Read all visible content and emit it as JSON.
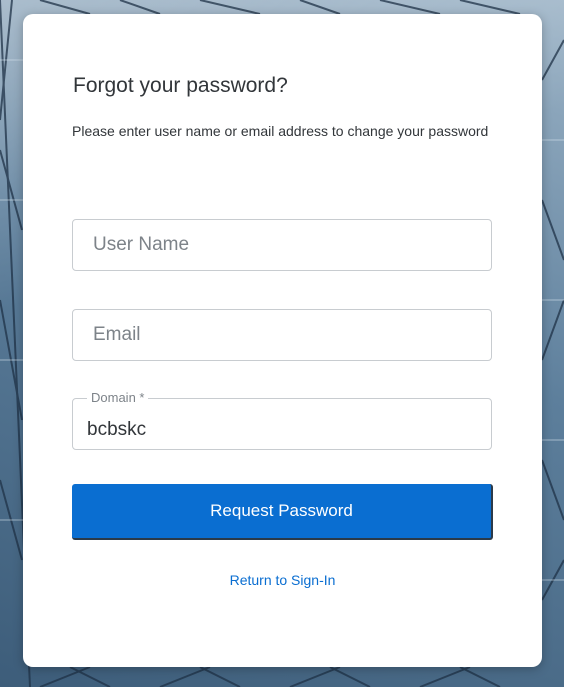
{
  "form": {
    "title": "Forgot your password?",
    "instructions": "Please enter user name or email address to change your password",
    "username": {
      "placeholder": "User Name",
      "value": ""
    },
    "email": {
      "placeholder": "Email",
      "value": ""
    },
    "domain": {
      "label": "Domain *",
      "value": "bcbskc"
    },
    "submit_label": "Request Password",
    "return_link_label": "Return to Sign-In"
  },
  "colors": {
    "primary": "#0a6ed1",
    "text": "#32363a",
    "placeholder": "#7d8389",
    "border": "#c8ccd0",
    "card": "#ffffff"
  }
}
